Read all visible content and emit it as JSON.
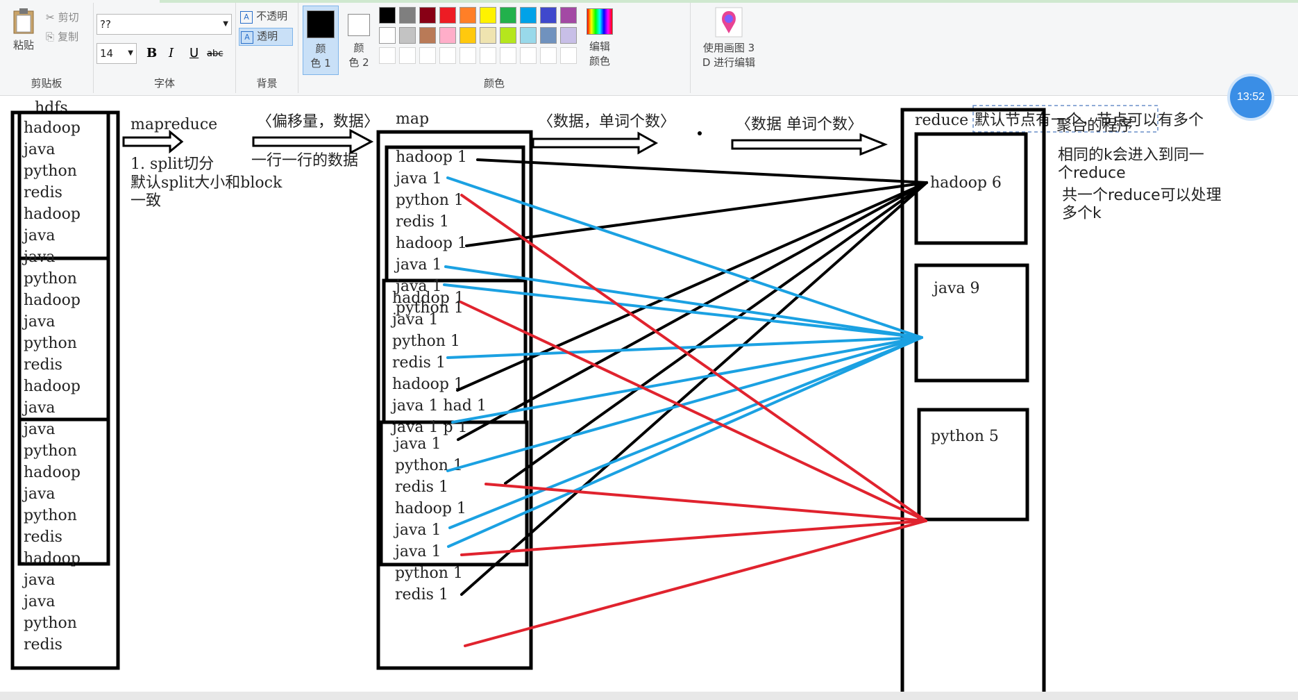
{
  "ribbon": {
    "clipboard": {
      "paste_label": "粘贴",
      "cut_label": "剪切",
      "copy_label": "复制",
      "group_label": "剪贴板"
    },
    "font": {
      "family_value": "??",
      "size_value": "14",
      "bold": "B",
      "italic": "I",
      "underline": "U",
      "strike": "abc",
      "group_label": "字体"
    },
    "background": {
      "opaque_label": "不透明",
      "transparent_label": "透明",
      "group_label": "背景"
    },
    "colors": {
      "color1_label_line1": "颜",
      "color1_label_line2": "色 1",
      "color2_label_line1": "颜",
      "color2_label_line2": "色 2",
      "edit_colors_line1": "编辑",
      "edit_colors_line2": "颜色",
      "group_label": "颜色",
      "color1": "#000000",
      "color2": "#ffffff",
      "palette_row1": [
        "#000000",
        "#7f7f7f",
        "#880015",
        "#ed1c24",
        "#ff7f27",
        "#fff200",
        "#22b14c",
        "#00a2e8",
        "#3f48cc",
        "#a349a4"
      ],
      "palette_row2": [
        "#ffffff",
        "#c3c3c3",
        "#b97a57",
        "#ffaec9",
        "#ffc90e",
        "#efe4b0",
        "#b5e61d",
        "#99d9ea",
        "#7092be",
        "#c8bfe7"
      ]
    },
    "paint3d": {
      "line1": "使用画图 3",
      "line2": "D 进行编辑"
    }
  },
  "clock": {
    "time": "13:52"
  },
  "drawing": {
    "hdfs_label": "hdfs",
    "hdfs_words": [
      "hadoop",
      "java",
      "python",
      "redis",
      "hadoop",
      "java",
      "java",
      "python",
      "hadoop",
      "java",
      "python",
      "redis",
      "hadoop",
      "java",
      "java",
      "python",
      "hadoop",
      "java",
      "python",
      "redis",
      "hadoop",
      "java",
      "java",
      "python",
      "redis"
    ],
    "mapreduce_label": "mapreduce",
    "split_note_line1": "1. split切分",
    "split_note_line2": "默认split大小和block",
    "split_note_line3": "一致",
    "offset_label": "〈偏移量，数据〉",
    "line_by_line": "一行一行的数据",
    "map_label": "map",
    "map_block1": [
      "hadoop  1",
      "java 1",
      "python 1",
      "redis 1",
      "hadoop 1",
      "java 1",
      "java 1",
      "python 1"
    ],
    "map_block2": [
      "haddop 1",
      "java 1",
      "python 1",
      "redis 1",
      "hadoop 1",
      "java 1  had 1",
      "java 1  p 1"
    ],
    "map_block3": [
      "java 1",
      "python 1",
      "redis 1",
      "hadoop 1",
      "java 1",
      "java 1",
      "python 1",
      "redis 1"
    ],
    "data_count_label": "〈数据，单词个数〉",
    "data_count_label2": "〈数据    单词个数〉",
    "reduce_label": "reduce",
    "reduce_note": "默认节点有一个，节点可以有多个",
    "note_aggregate": "聚合的程序",
    "note_samek_line1": "相同的k会进入到同一",
    "note_samek_line2": "个reduce",
    "note_one_reduce_line1": "共一个reduce可以处理",
    "note_one_reduce_line2": "多个k",
    "reduce_hadoop": "hadoop 6",
    "reduce_java": "java  9",
    "reduce_python": "python  5",
    "line_colors": {
      "hadoop": "#000000",
      "java": "#1ba1e2",
      "python": "#e0232e"
    }
  }
}
